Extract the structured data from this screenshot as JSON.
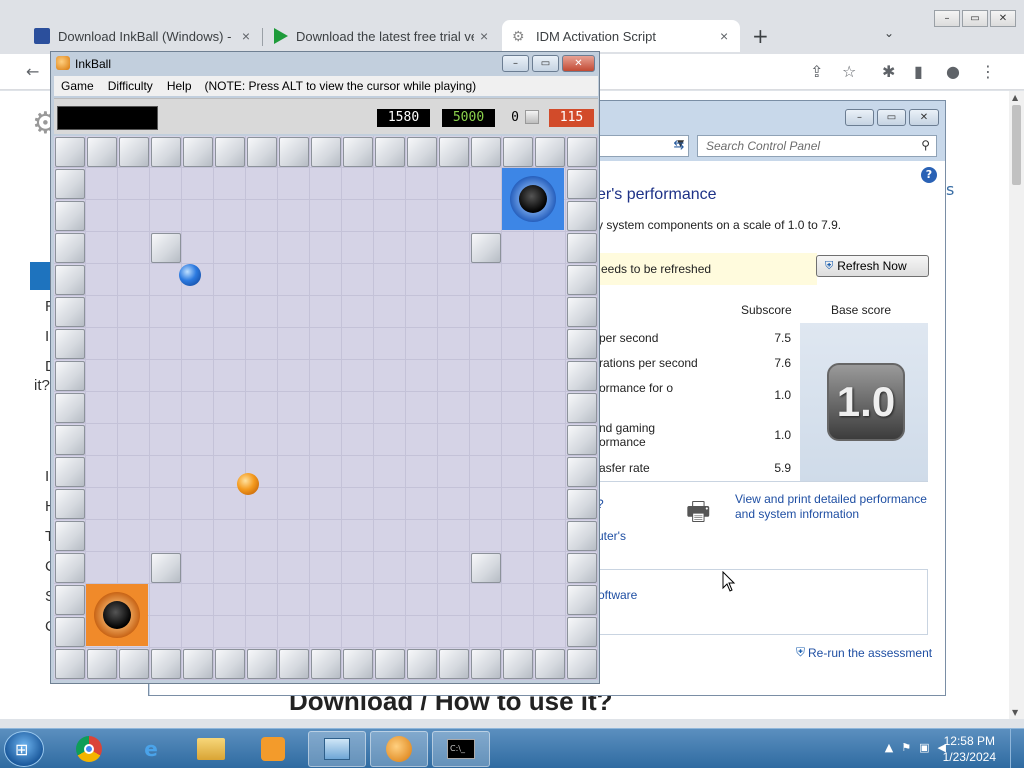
{
  "browser": {
    "tabs": [
      {
        "title": "Download InkBall (Windows) - M",
        "close": "×"
      },
      {
        "title": "Download the latest free trial ver",
        "close": "×"
      },
      {
        "title": "IDM Activation Script",
        "close": "×"
      }
    ],
    "new_tab": "+",
    "tab_search": "⌄",
    "window_controls": {
      "minimize": "–",
      "maximize": "▭",
      "close": "✕"
    },
    "toolbar_icons": {
      "back": "←",
      "share": "⇪",
      "star": "☆",
      "extensions": "✱",
      "sidepanel": "▮",
      "profile": "●",
      "menu": "⋮"
    }
  },
  "page": {
    "heading": "Download / How to use it?",
    "left_fragments": [
      "R",
      "I",
      "D",
      "it?",
      "I",
      "H",
      "T",
      "C",
      "S",
      "C"
    ],
    "right_fragment": "s"
  },
  "control_panel": {
    "search_placeholder": "Search Control Panel",
    "title": "er's performance",
    "subtitle": "y system components on a scale of 1.0 to 7.9.",
    "notice": "eeds to be refreshed",
    "refresh_button": "Refresh Now",
    "col_subscore": "Subscore",
    "col_basescore": "Base score",
    "rows": [
      {
        "component": "per second",
        "score": "7.5"
      },
      {
        "component": "rations per second",
        "score": "7.6"
      },
      {
        "component": "ormance for o",
        "score": "1.0"
      },
      {
        "component": "nd gaming ormance",
        "score": "1.0"
      },
      {
        "component": "asfer rate",
        "score": "5.9"
      }
    ],
    "base_score": "1.0",
    "print_link": "View and print detailed performance and system information",
    "q_fragment": "?",
    "link_computer": "uter's",
    "link_software": "oftware",
    "rerun_link": "Re-run the assessment"
  },
  "inkball": {
    "title": "InkBall",
    "menu": [
      "Game",
      "Difficulty",
      "Help"
    ],
    "note": "(NOTE: Press ALT to view the cursor while playing)",
    "score": "1580",
    "target": "5000",
    "count": "0",
    "time": "115"
  },
  "taskbar": {
    "clock_time": "12:58 PM",
    "clock_date": "1/23/2024",
    "tray_icons": [
      "▲",
      "⚑",
      "▣",
      "◀"
    ]
  }
}
